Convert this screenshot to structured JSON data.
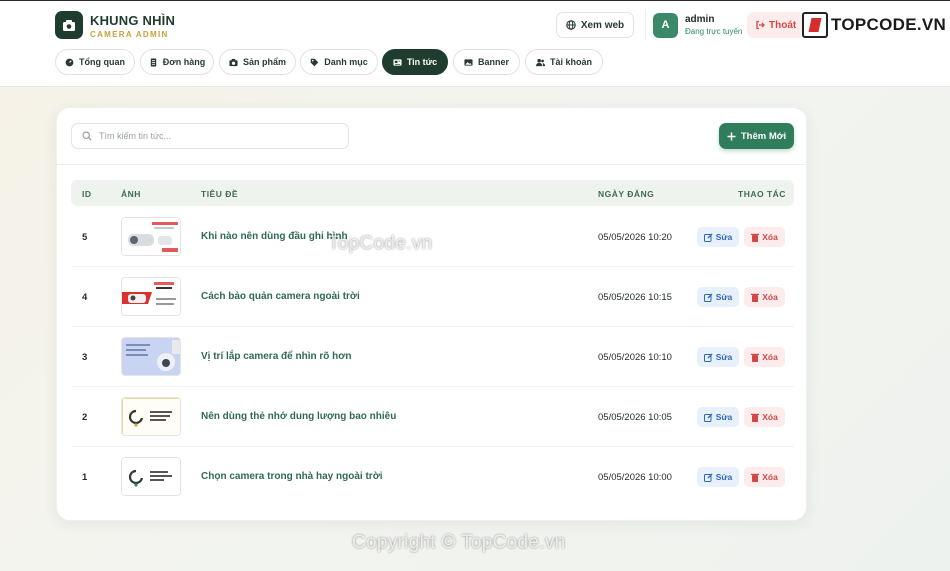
{
  "brand": {
    "title": "KHUNG NHÌN",
    "subtitle": "CAMERA ADMIN"
  },
  "header": {
    "view_site": "Xem web",
    "user": {
      "initial": "A",
      "name": "admin",
      "status": "Đang trực tuyến"
    },
    "logout": "Thoát"
  },
  "watermark": {
    "logo_text": "TOPCODE.VN",
    "overlay": "TopCode.vn",
    "copyright": "Copyright © TopCode.vn"
  },
  "nav": {
    "tabs": [
      {
        "label": "Tổng quan",
        "icon": "gauge-icon"
      },
      {
        "label": "Đơn hàng",
        "icon": "receipt-icon"
      },
      {
        "label": "Sản phẩm",
        "icon": "camera-icon"
      },
      {
        "label": "Danh mục",
        "icon": "tag-icon"
      },
      {
        "label": "Tin tức",
        "icon": "newspaper-icon",
        "active": true
      },
      {
        "label": "Banner",
        "icon": "image-icon"
      },
      {
        "label": "Tài khoản",
        "icon": "users-icon"
      }
    ]
  },
  "toolbar": {
    "search_placeholder": "Tìm kiếm tin tức...",
    "add_label": "Thêm Mới"
  },
  "table": {
    "columns": {
      "id": "ID",
      "image": "ẢNH",
      "title": "TIÊU ĐỀ",
      "date": "NGÀY ĐĂNG",
      "actions": "THAO TÁC"
    },
    "edit_label": "Sửa",
    "delete_label": "Xóa",
    "rows": [
      {
        "id": "5",
        "title": "Khi nào nên dùng đầu ghi hình",
        "date": "05/05/2026 10:20"
      },
      {
        "id": "4",
        "title": "Cách bảo quản camera ngoài trời",
        "date": "05/05/2026 10:15"
      },
      {
        "id": "3",
        "title": "Vị trí lắp camera để nhìn rõ hơn",
        "date": "05/05/2026 10:10"
      },
      {
        "id": "2",
        "title": "Nên dùng thẻ nhớ dung lượng bao nhiêu",
        "date": "05/05/2026 10:05"
      },
      {
        "id": "1",
        "title": "Chọn camera trong nhà hay ngoài trời",
        "date": "05/05/2026 10:00"
      }
    ]
  },
  "colors": {
    "primary": "#1f3d2f",
    "accent": "#2f7d5a",
    "gold": "#c9a13b",
    "danger": "#d04848",
    "info": "#2f68b0"
  }
}
